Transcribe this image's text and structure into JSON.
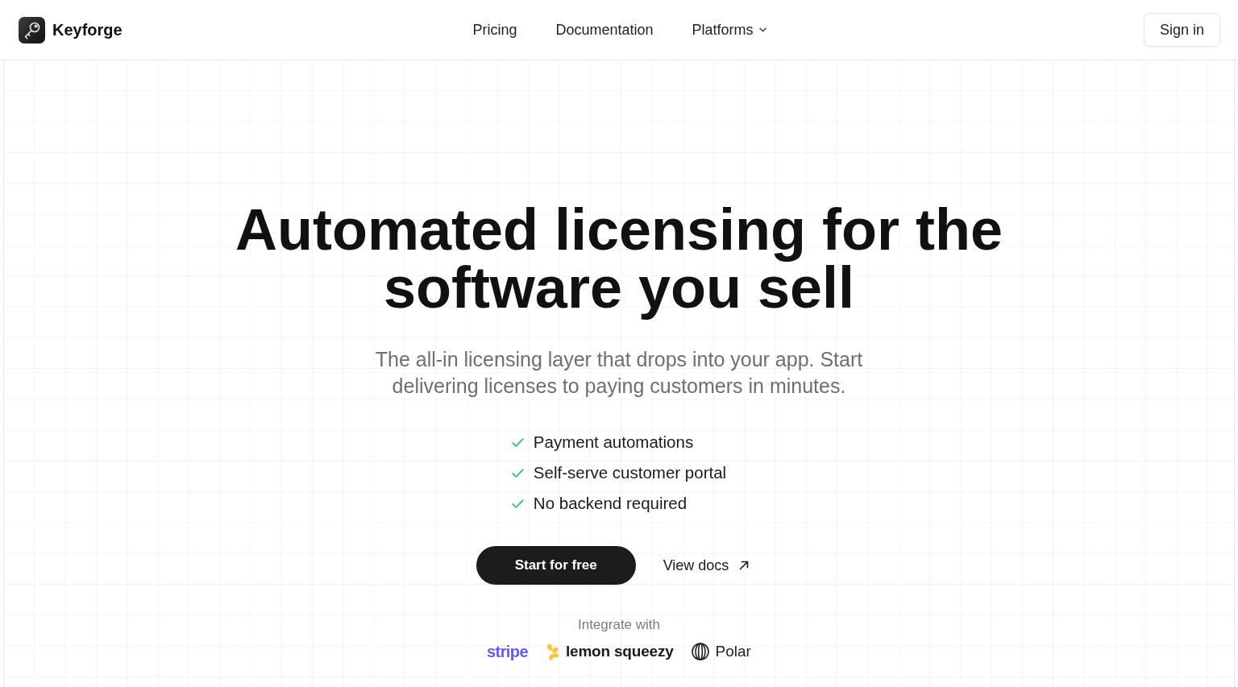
{
  "header": {
    "brand": {
      "name": "Keyforge"
    },
    "nav": [
      {
        "label": "Pricing",
        "kind": "link"
      },
      {
        "label": "Documentation",
        "kind": "link"
      },
      {
        "label": "Platforms",
        "kind": "dropdown"
      }
    ],
    "sign_in": {
      "label": "Sign in"
    }
  },
  "hero": {
    "headline": "Automated licensing for the software you sell",
    "subtitle": "The all-in licensing layer that drops into your app. Start delivering licenses to paying customers in minutes.",
    "features": [
      {
        "label": "Payment automations"
      },
      {
        "label": "Self-serve customer portal"
      },
      {
        "label": "No backend required"
      }
    ],
    "actions": [
      {
        "label": "Start for free",
        "kind": "primary"
      },
      {
        "label": "View docs",
        "kind": "external_link"
      }
    ],
    "integrations": {
      "label": "Integrate with",
      "partners": [
        {
          "name": "stripe",
          "kind": "wordmark"
        },
        {
          "name": "lemon squeezy",
          "kind": "lemon"
        },
        {
          "name": "Polar",
          "kind": "sphere"
        }
      ]
    }
  }
}
